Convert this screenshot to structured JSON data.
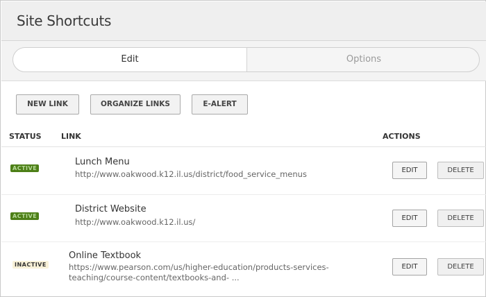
{
  "header": {
    "title": "Site Shortcuts"
  },
  "tabs": [
    {
      "label": "Edit",
      "active": true
    },
    {
      "label": "Options",
      "active": false
    }
  ],
  "toolbar": {
    "new_link": "NEW LINK",
    "organize_links": "ORGANIZE LINKS",
    "e_alert": "E-ALERT"
  },
  "table": {
    "columns": {
      "status": "STATUS",
      "link": "LINK",
      "actions": "ACTIONS"
    },
    "rows": [
      {
        "status": "ACTIVE",
        "title": "Lunch Menu",
        "url": "http://www.oakwood.k12.il.us/district/food_service_menus",
        "edit": "EDIT",
        "delete": "DELETE"
      },
      {
        "status": "ACTIVE",
        "title": "District Website",
        "url": "http://www.oakwood.k12.il.us/",
        "edit": "EDIT",
        "delete": "DELETE"
      },
      {
        "status": "INACTIVE",
        "title": "Online Textbook",
        "url_line1": "https://www.pearson.com/us/higher-education/products-services-",
        "url_line2": "teaching/course-content/textbooks-and- ...",
        "edit": "EDIT",
        "delete": "DELETE"
      }
    ]
  },
  "colors": {
    "active_badge_bg": "#4d7f17",
    "inactive_badge_bg": "#f8f1d8",
    "header_bg": "#efefef"
  }
}
